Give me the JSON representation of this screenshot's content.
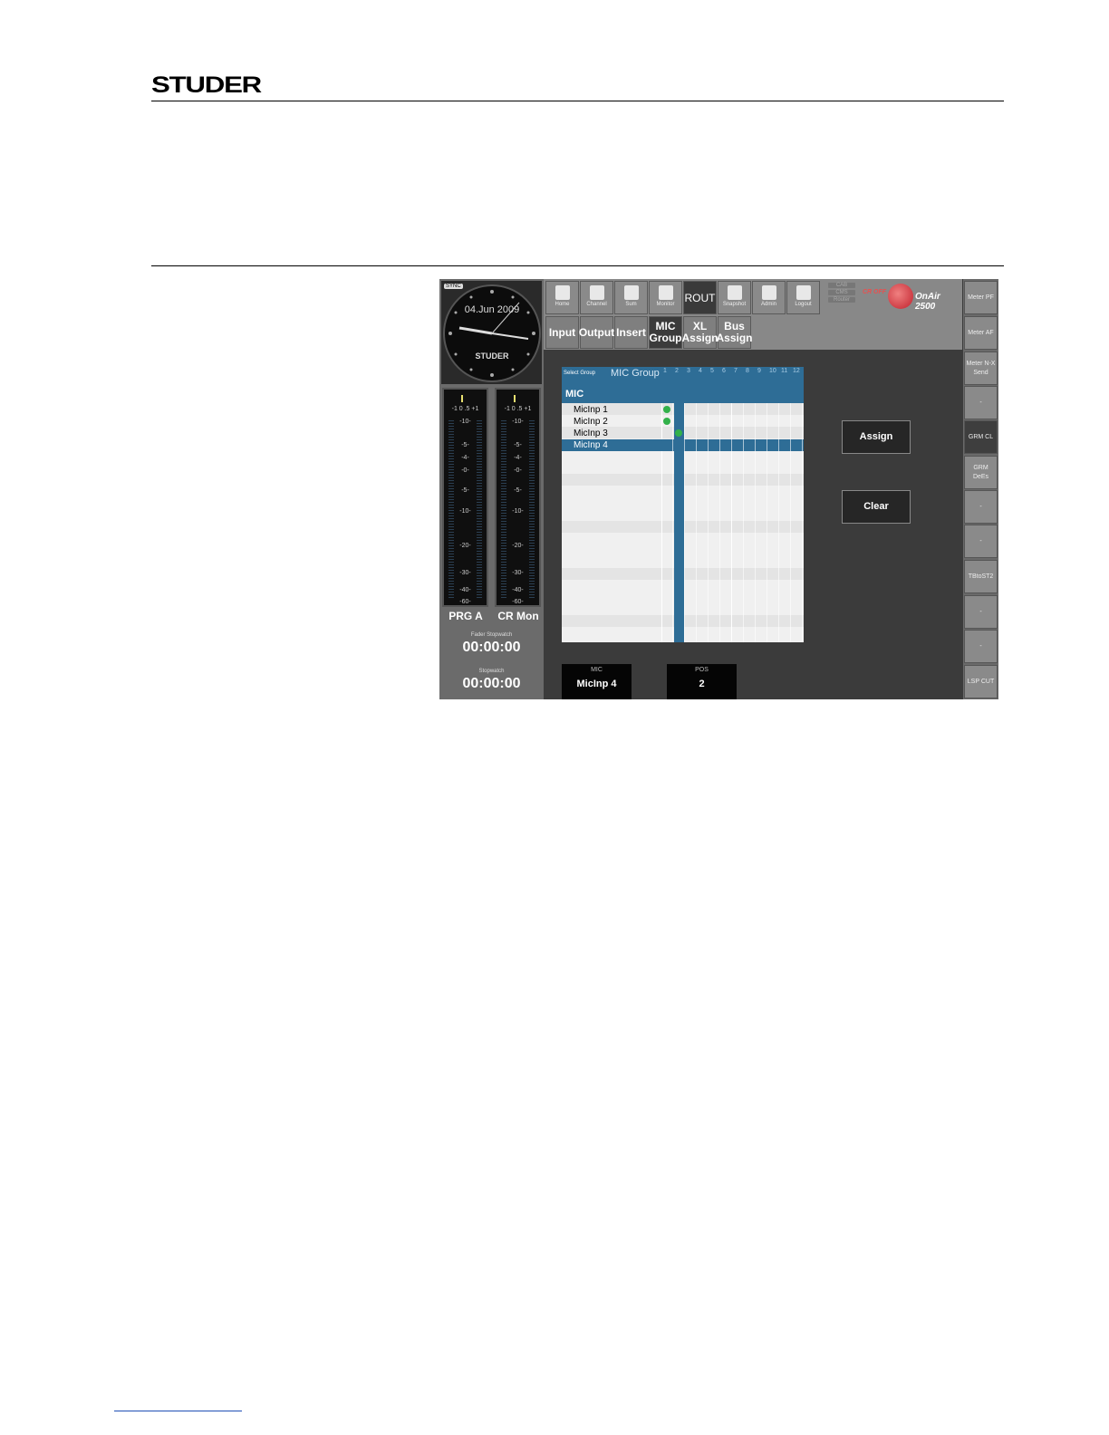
{
  "header": {
    "brand": "STUDER"
  },
  "clock": {
    "date": "04.Jun 2009",
    "sync": "SYNC",
    "brand": "STUDER",
    "corner": "Cutter"
  },
  "meters": [
    {
      "label": "PRG A",
      "top_ticks": "-1  0  .5  +1",
      "scale": [
        "-10-",
        "-5-",
        "-4-",
        "-0-",
        "-5-",
        "-10-",
        "-20-",
        "-30-",
        "-40-",
        "-60-"
      ]
    },
    {
      "label": "CR Mon",
      "top_ticks": "-1  0  .5  +1",
      "scale": [
        "-10-",
        "-5-",
        "-4-",
        "-0-",
        "-5-",
        "-10-",
        "-20-",
        "-30-",
        "-40-",
        "-60-"
      ]
    }
  ],
  "stopwatch": {
    "fader_label": "Fader Stopwatch",
    "fader_value": "00:00:00",
    "label": "Stopwatch",
    "value": "00:00:00"
  },
  "toolbar": {
    "buttons": [
      "Home",
      "Channel",
      "Sum",
      "Monitor",
      "ROUT",
      "Snapshot",
      "Admin",
      "Logout"
    ],
    "cab": [
      "CAB",
      "CMS",
      "Router"
    ],
    "off": "CR OFF",
    "product": "OnAir 2500"
  },
  "tabs": [
    "Input",
    "Output",
    "Insert",
    "MIC Group",
    "XL Assign",
    "Bus Assign"
  ],
  "sidebar": [
    "Meter PF",
    "Meter AF",
    "Meter N-X Send",
    "-",
    "GRM CL",
    "GRM DeEs",
    "-",
    "-",
    "TBtoST2",
    "-",
    "-",
    "LSP CUT"
  ],
  "grid": {
    "select_group": "Select Group",
    "group_name": "MIC Group",
    "title": "MIC",
    "columns": [
      "1",
      "2",
      "3",
      "4",
      "5",
      "6",
      "7",
      "8",
      "9",
      "10",
      "11",
      "12"
    ],
    "rows": [
      "MicInp 1",
      "MicInp 2",
      "MicInp 3",
      "MicInp 4"
    ],
    "assign": [
      1,
      1,
      2,
      0
    ]
  },
  "actions": {
    "assign": "Assign",
    "clear": "Clear"
  },
  "info": {
    "mic_label": "MIC",
    "mic_value": "MicInp 4",
    "pos_label": "POS",
    "pos_value": "2"
  }
}
